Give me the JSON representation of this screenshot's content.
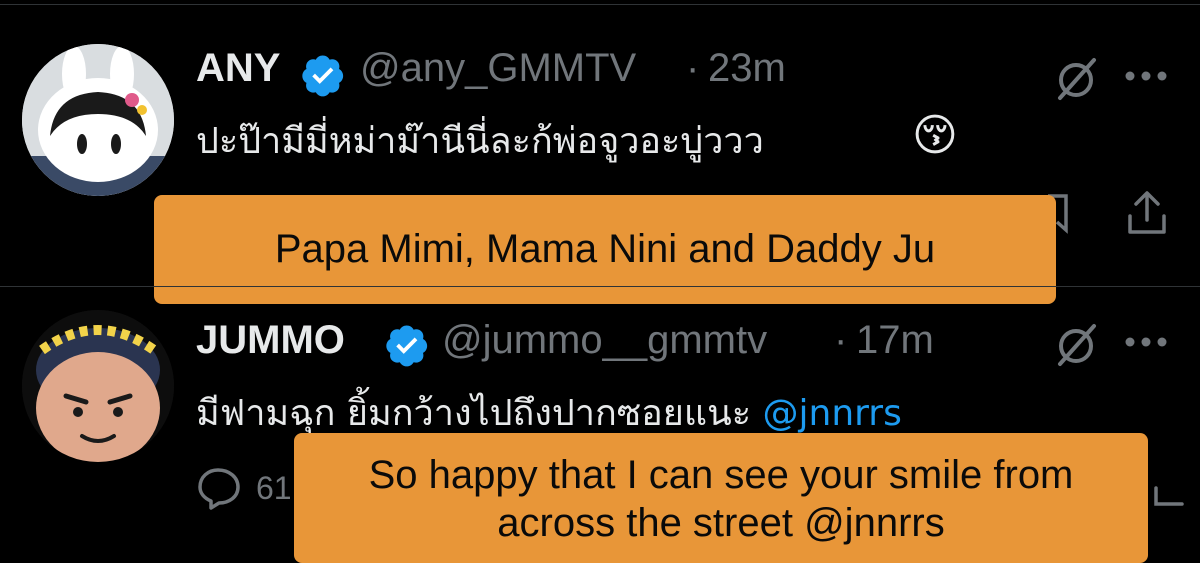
{
  "tweets": [
    {
      "name": "ANY",
      "handle": "@any_GMMTV",
      "separator": "·",
      "time": "23m",
      "text": "ปะป๊ามีมี่หม่าม๊านีนี่ละก้พ่อจูวอะบู่ววว",
      "emoji": "😚",
      "caption": "Papa Mimi, Mama Nini and Daddy Ju"
    },
    {
      "name": "JUMMO",
      "handle": "@jummo__gmmtv",
      "separator": "·",
      "time": "17m",
      "text": "มีฟามฉุก ยิ้มกว้างไปถึงปากซอยแนะ ",
      "mention": "@jnnrrs",
      "reply_count": "61",
      "caption_line1": "So happy that I can see your smile from",
      "caption_line2": "across the street @jnnrrs"
    }
  ],
  "colors": {
    "background": "#000000",
    "verified": "#1d9bf0",
    "caption_bg": "#e89638",
    "muted": "#71767b"
  },
  "icons": [
    "verified-badge-icon",
    "grok-icon",
    "more-icon",
    "reply-icon",
    "share-icon"
  ]
}
